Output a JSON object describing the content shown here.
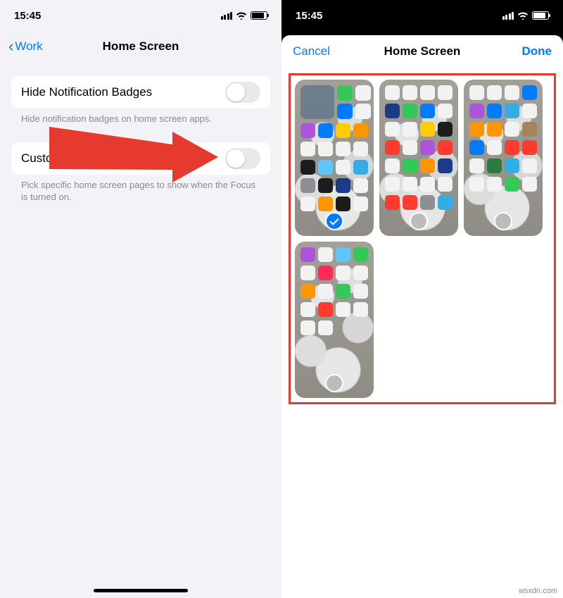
{
  "left": {
    "status_time": "15:45",
    "nav_back_label": "Work",
    "nav_title": "Home Screen",
    "row1_label": "Hide Notification Badges",
    "row1_caption": "Hide notification badges on home screen apps.",
    "row1_value": false,
    "row2_label": "Custom Pages",
    "row2_caption": "Pick specific home screen pages to show when the Focus is turned on.",
    "row2_value": false
  },
  "right": {
    "status_time": "15:45",
    "nav_cancel": "Cancel",
    "nav_title": "Home Screen",
    "nav_done": "Done",
    "pages": [
      {
        "selected": true,
        "has_widget": true
      },
      {
        "selected": false,
        "has_widget": false
      },
      {
        "selected": false,
        "has_widget": false
      },
      {
        "selected": false,
        "has_widget": false
      }
    ]
  },
  "watermark": "wsxdn.com",
  "icons": {
    "chevron_left": "‹",
    "wifi": "wifi",
    "signal": "signal",
    "battery": "battery"
  }
}
